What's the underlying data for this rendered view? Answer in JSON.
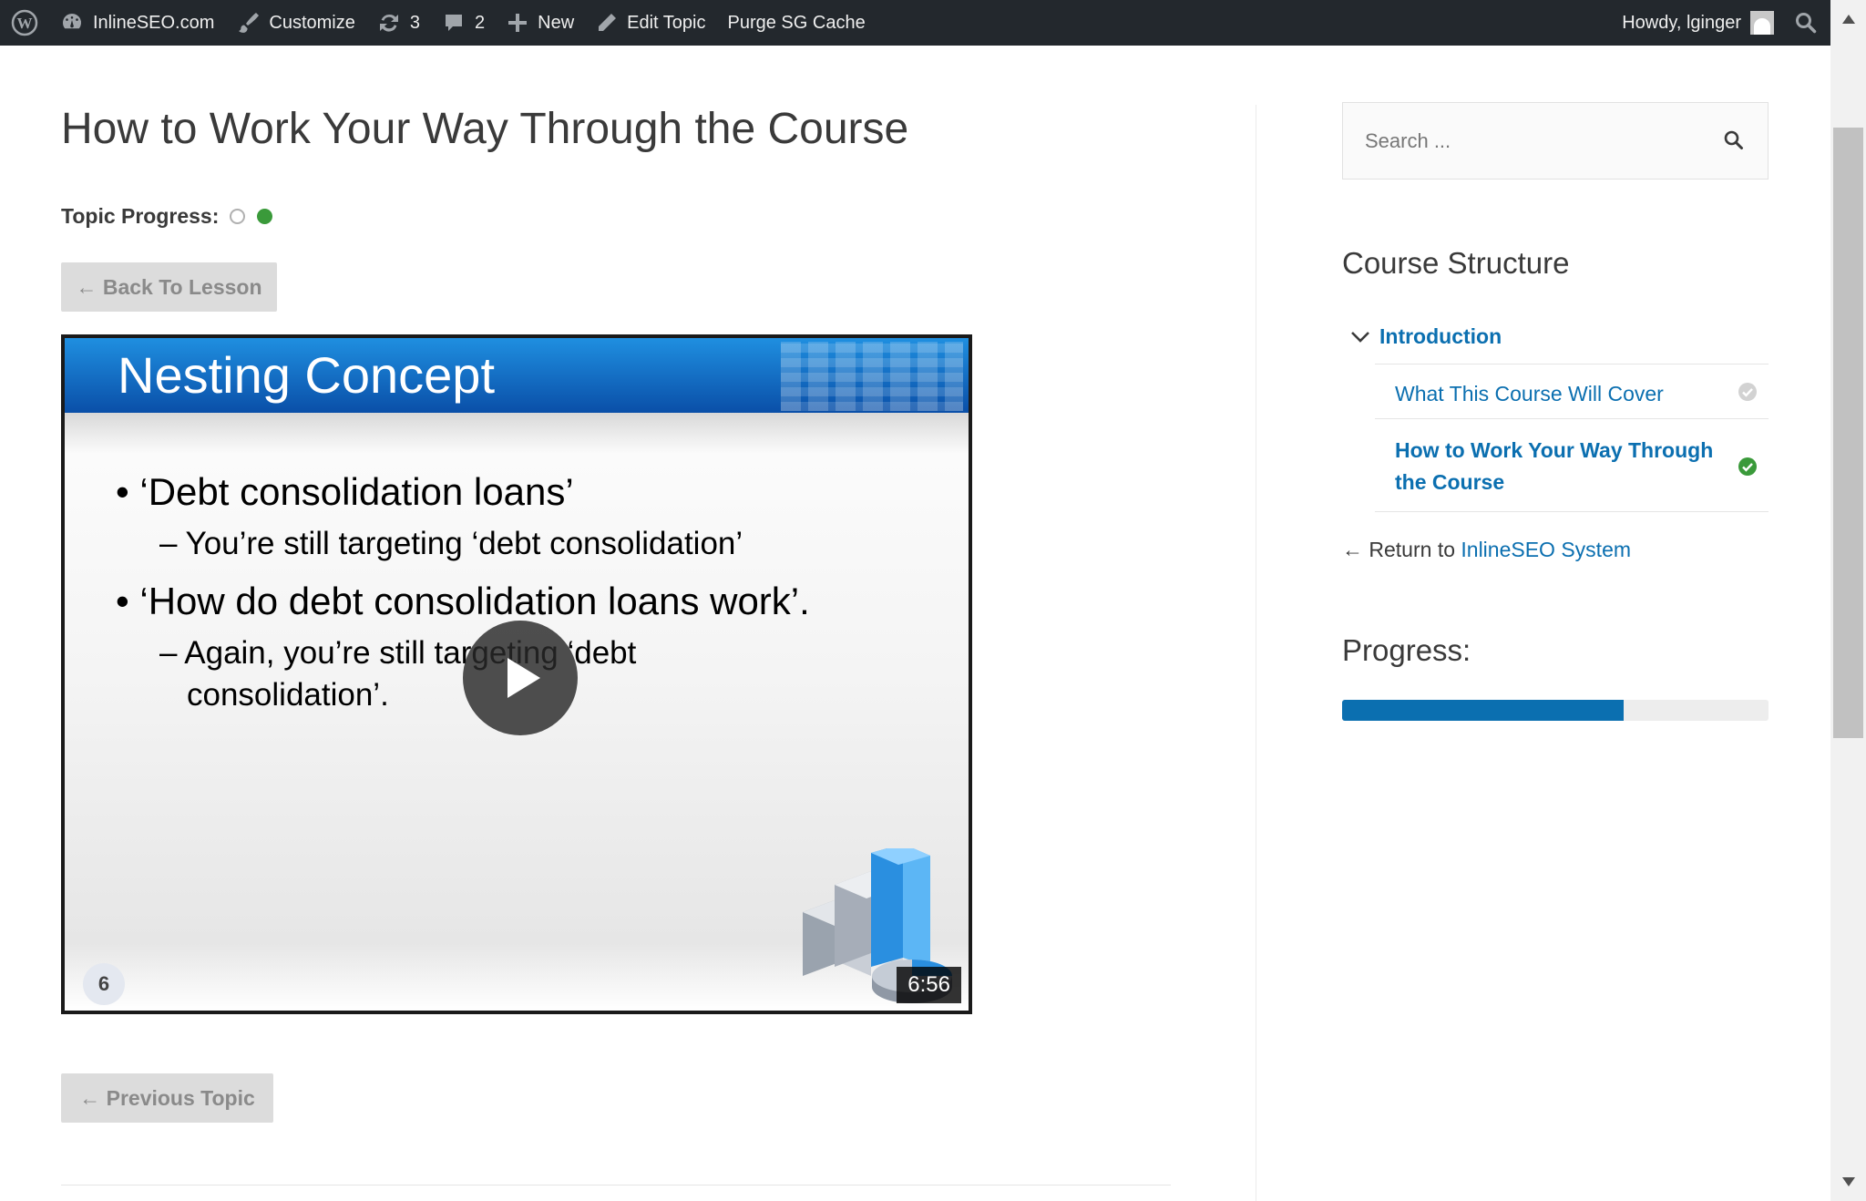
{
  "adminbar": {
    "site_name": "InlineSEO.com",
    "customize": "Customize",
    "updates_count": "3",
    "comments_count": "2",
    "new_label": "New",
    "edit_topic": "Edit Topic",
    "purge_cache": "Purge SG Cache",
    "howdy": "Howdy, lginger"
  },
  "main": {
    "title": "How to Work Your Way Through the Course",
    "topic_progress_label": "Topic Progress:",
    "back_button": "← Back To Lesson",
    "previous_button": "← Previous Topic"
  },
  "video": {
    "slide_title": "Nesting Concept",
    "bullet_1": "•  ‘Debt consolidation loans’",
    "sub_1": "– You’re still targeting ‘debt consolidation’",
    "bullet_2": "•  ‘How do debt consolidation loans work’.",
    "sub_2": "– Again, you’re still targeting ‘debt",
    "sub_3": "consolidation’.",
    "slide_number": "6",
    "duration": "6:56"
  },
  "sidebar": {
    "search_placeholder": "Search ...",
    "course_structure_title": "Course Structure",
    "lesson_label": "Introduction",
    "topics": [
      {
        "label": "What This Course Will Cover",
        "status": "incomplete"
      },
      {
        "label": "How to Work Your Way Through the Course",
        "status": "complete"
      }
    ],
    "return_prefix": "← Return to ",
    "return_link": "InlineSEO System",
    "progress_title": "Progress:",
    "progress_percent": 66
  },
  "colors": {
    "adminbar_bg": "#23282d",
    "link_blue": "#0b6fb0",
    "complete_green": "#3a9a3a",
    "button_grey": "#dcdcdc"
  }
}
